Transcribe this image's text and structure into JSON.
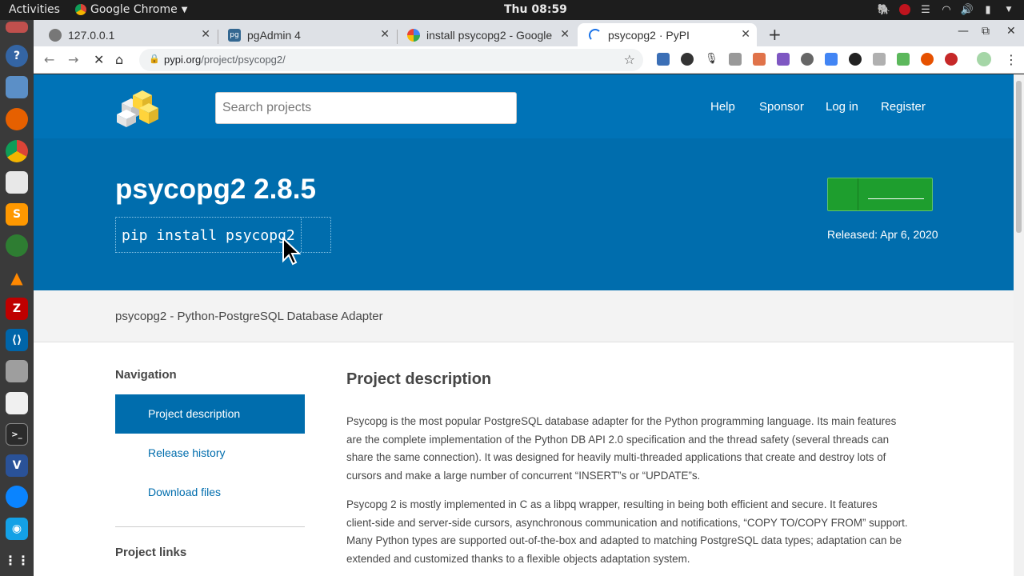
{
  "topbar": {
    "activities": "Activities",
    "app_name": "Google Chrome",
    "clock": "Thu 08:59"
  },
  "tabs": [
    {
      "title": "127.0.0.1",
      "favicon": "globe-icon"
    },
    {
      "title": "pgAdmin 4",
      "favicon": "pgadmin-icon"
    },
    {
      "title": "install psycopg2 - Google",
      "favicon": "google-icon"
    },
    {
      "title": "psycopg2 · PyPI",
      "favicon": "loading-spinner-icon"
    }
  ],
  "toolbar": {
    "url_host": "pypi.org",
    "url_path": "/project/psycopg2/"
  },
  "header": {
    "search_placeholder": "Search projects",
    "nav": [
      "Help",
      "Sponsor",
      "Log in",
      "Register"
    ]
  },
  "package": {
    "title": "psycopg2 2.8.5",
    "pip_command": "pip install psycopg2",
    "released": "Released: Apr 6, 2020",
    "summary": "psycopg2 - Python-PostgreSQL Database Adapter"
  },
  "sidebar": {
    "title": "Navigation",
    "items": [
      "Project description",
      "Release history",
      "Download files"
    ],
    "links_title": "Project links"
  },
  "description": {
    "title": "Project description",
    "p1": [
      "Psycopg is the most popular PostgreSQL database adapter for the Python programming language. Its main features",
      "are the complete implementation of the Python DB API 2.0 specification and the thread safety (several threads can",
      "share the same connection). It was designed for heavily multi-threaded applications that create and destroy lots of",
      "cursors and make a large number of concurrent “INSERT”s or “UPDATE”s."
    ],
    "p2": [
      "Psycopg 2 is mostly implemented in C as a libpq wrapper, resulting in being both efficient and secure. It features",
      "client-side and server-side cursors, asynchronous communication and notifications, “COPY TO/COPY FROM” support.",
      "Many Python types are supported out-of-the-box and adapted to matching PostgreSQL data types; adaptation can be",
      "extended and customized thanks to a flexible objects adaptation system."
    ]
  },
  "colors": {
    "pypi_blue": "#006dad",
    "install_green": "#1e9e2e"
  }
}
